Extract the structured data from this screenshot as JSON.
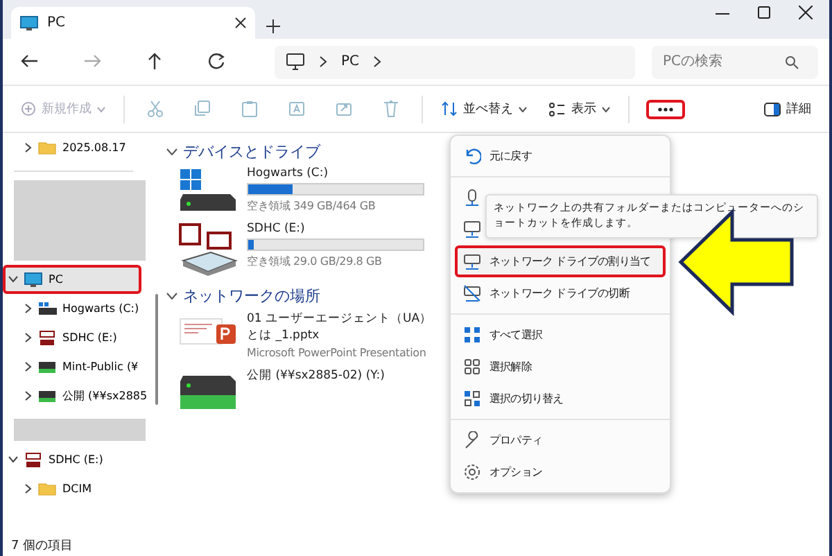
{
  "window": {
    "tabs": [
      {
        "title": "PC",
        "selected": true
      }
    ]
  },
  "address": {
    "crumbs": [
      "PC"
    ]
  },
  "search": {
    "placeholder": "PCの検索"
  },
  "toolbar": {
    "new_label": "新規作成",
    "sort_label": "並べ替え",
    "view_label": "表示",
    "details_label": "詳細"
  },
  "sidebar": {
    "items": [
      {
        "label": "2025.08.17",
        "kind": "folder",
        "expanded": false,
        "selected": false
      },
      {
        "kind": "redacted"
      },
      {
        "label": "PC",
        "kind": "pc",
        "expanded": true,
        "selected": true,
        "children": [
          {
            "label": "Hogwarts (C:)",
            "kind": "system",
            "expanded": false,
            "selected": false
          },
          {
            "label": "SDHC (E:)",
            "kind": "sd",
            "expanded": false,
            "selected": false
          },
          {
            "label": "Mint-Public (¥",
            "kind": "network",
            "expanded": false,
            "selected": false
          },
          {
            "label": "公開 (¥¥sx2885",
            "kind": "network",
            "expanded": false,
            "selected": false
          }
        ]
      },
      {
        "kind": "redacted"
      },
      {
        "label": "SDHC (E:)",
        "kind": "sd",
        "expanded": true,
        "selected": false,
        "children": [
          {
            "label": "DCIM",
            "kind": "folder",
            "expanded": false,
            "selected": false
          }
        ]
      }
    ]
  },
  "sections": [
    {
      "title": "デバイスとドライブ",
      "items": [
        {
          "name": "Hogwarts (C:)",
          "kind": "system",
          "level": 0.25,
          "free": "空き領域 349 GB/464 GB"
        },
        {
          "name": "SDHC (E:)",
          "kind": "sd",
          "level": 0.03,
          "free": "空き領域 29.0 GB/29.8 GB"
        }
      ]
    },
    {
      "title": "ネットワークの場所",
      "items": [
        {
          "name": "01 ユーザーエージェント（UA）とは _1.pptx",
          "kind": "pptx",
          "subtitle": "Microsoft PowerPoint Presentation"
        },
        {
          "name": "公開 (¥¥sx2885-02) (Y:)",
          "kind": "network"
        }
      ]
    }
  ],
  "menu": {
    "items": [
      {
        "kind": "undo",
        "label": "元に戻す",
        "highlighted": false
      },
      {
        "kind": "separator"
      },
      {
        "kind": "media",
        "highlighted": false
      },
      {
        "kind": "netloc",
        "highlighted": false
      },
      {
        "kind": "mapdrive",
        "label": "ネットワーク ドライブの割り当て",
        "highlighted": true
      },
      {
        "kind": "disconnect",
        "label": "ネットワーク ドライブの切断",
        "highlighted": false
      },
      {
        "kind": "separator"
      },
      {
        "kind": "selectall",
        "label": "すべて選択",
        "highlighted": false
      },
      {
        "kind": "selectnone",
        "label": "選択解除",
        "highlighted": false
      },
      {
        "kind": "invert",
        "label": "選択の切り替え",
        "highlighted": false
      },
      {
        "kind": "separator"
      },
      {
        "kind": "properties",
        "label": "プロパティ",
        "highlighted": false
      },
      {
        "kind": "options",
        "label": "オプション",
        "highlighted": false
      }
    ]
  },
  "tooltip": {
    "text": "ネットワーク上の共有フォルダーまたはコンピューターへのショートカットを作成します。"
  },
  "status_bar": {
    "text": "7 個の項目"
  }
}
